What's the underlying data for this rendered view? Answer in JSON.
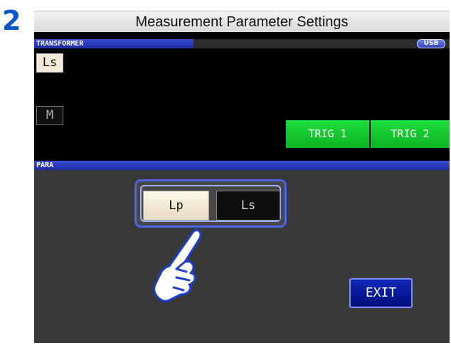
{
  "step": {
    "number": "2"
  },
  "title": "Measurement Parameter Settings",
  "top_section": {
    "label": "TRANSFORMER",
    "usb_badge": "USB",
    "param_primary": "Ls",
    "param_secondary": "M",
    "trig_buttons": [
      "TRIG 1",
      "TRIG 2"
    ]
  },
  "para_section": {
    "label": "PARA",
    "options": [
      {
        "label": "Lp",
        "selected": true
      },
      {
        "label": "Ls",
        "selected": false
      }
    ]
  },
  "exit_label": "EXIT",
  "colors": {
    "accent_blue": "#1b2aa8",
    "trig_green": "#0cb324",
    "highlight_frame": "#4b63e6",
    "step_number": "#0a55c8"
  },
  "icons": {
    "pointer": "pointing-hand-icon"
  }
}
